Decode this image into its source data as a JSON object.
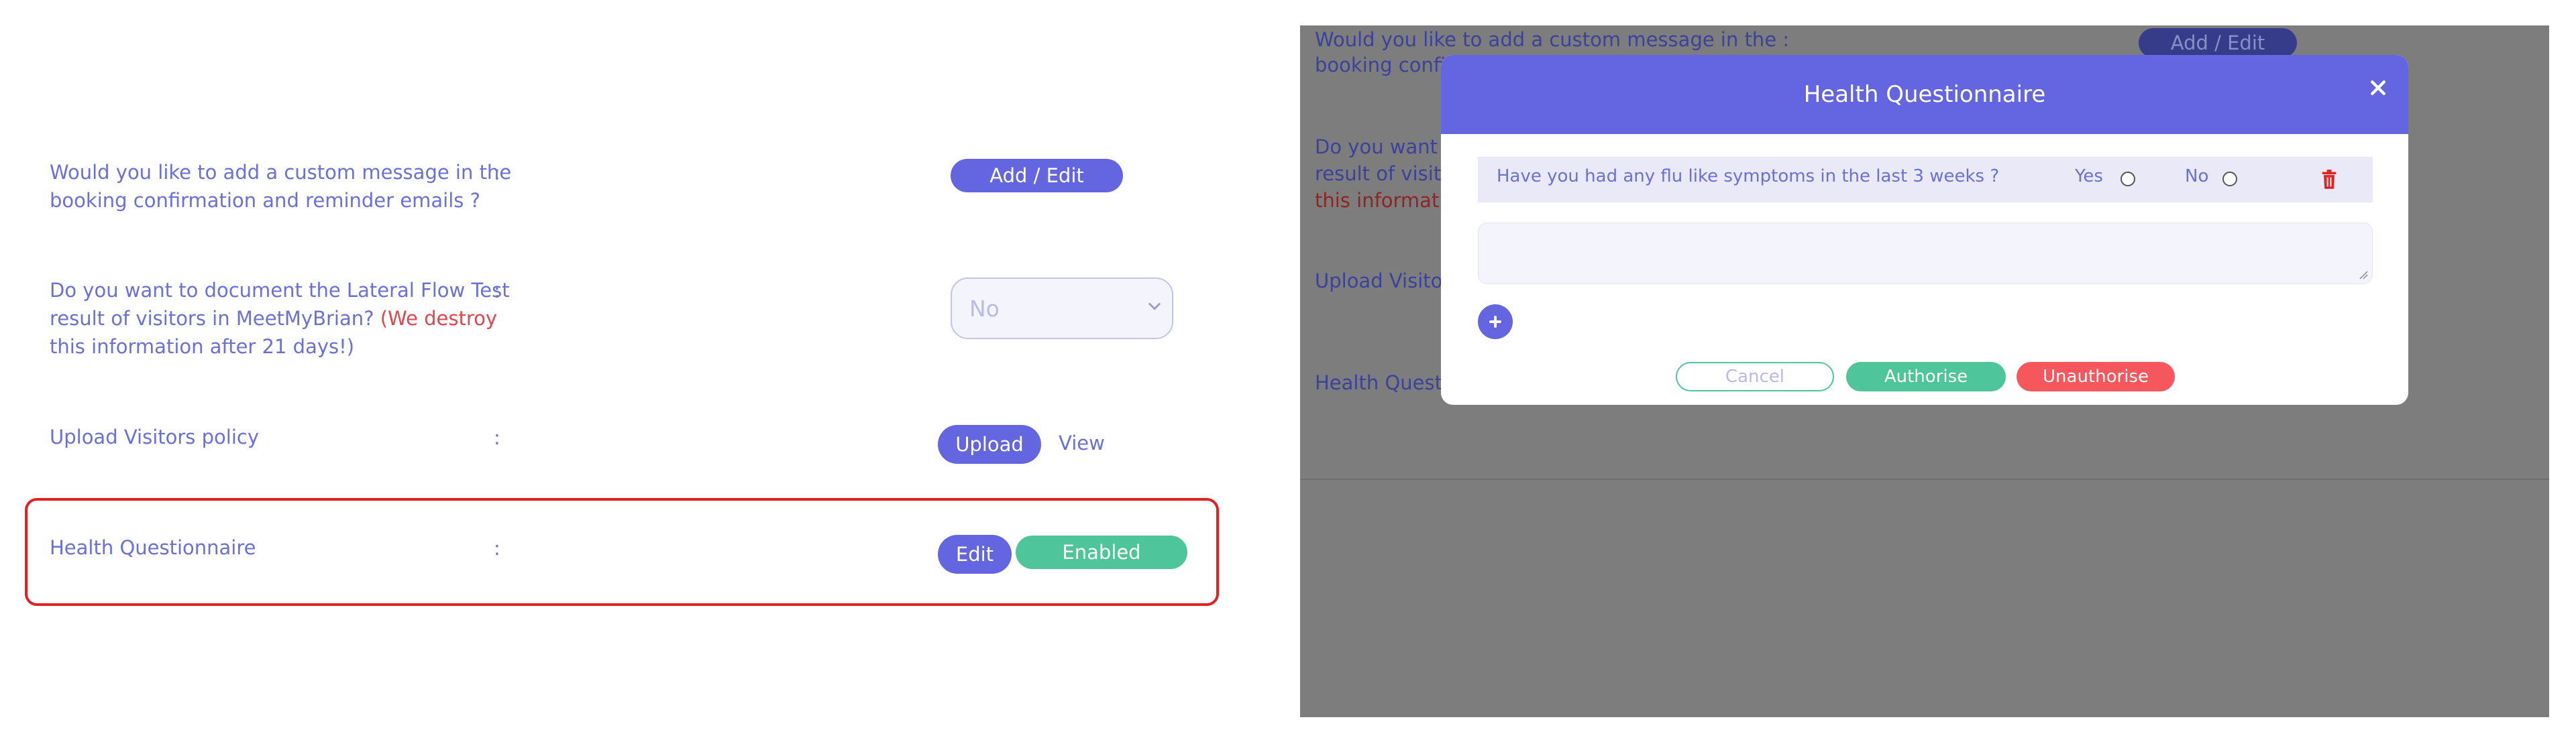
{
  "settings": {
    "custom_message": {
      "label_line1": "Would you like to add a custom message in the",
      "label_line2": "booking confirmation and reminder emails ?",
      "colon": ":",
      "button": "Add / Edit"
    },
    "lateral_flow": {
      "label_line1": "Do you want to document the Lateral Flow Test",
      "label_line2_prefix": "result of visitors in MeetMyBrian?",
      "label_line2_warning": "(We destroy",
      "label_line3_warning": "this information after 21 days!)",
      "colon": ":",
      "select_value": "No"
    },
    "visitors_policy": {
      "label": "Upload Visitors policy",
      "colon": ":",
      "upload_button": "Upload",
      "view_link": "View"
    },
    "health_questionnaire": {
      "label": "Health Questionnaire",
      "colon": ":",
      "edit_button": "Edit",
      "status": "Enabled"
    }
  },
  "background_overlay": {
    "custom_message_line1": "Would you like to add a custom message in the :",
    "custom_message_line2": "booking confir",
    "add_edit": "Add / Edit",
    "lateral_line1": "Do you want to",
    "lateral_line2": "result of visitor",
    "lateral_line3": "this informatio",
    "upload_label": "Upload Visitors",
    "health_label": "Health Questio"
  },
  "modal": {
    "title": "Health Questionnaire",
    "question": "Have you had any flu like symptoms in the last 3 weeks ?",
    "option_yes": "Yes",
    "option_no": "No",
    "cancel": "Cancel",
    "authorise": "Authorise",
    "unauthorise": "Unauthorise"
  },
  "icons": {
    "close": "close-icon",
    "trash": "trash-icon",
    "add": "plus-icon",
    "chevron": "chevron-down-icon"
  },
  "colors": {
    "primary": "#6366e0",
    "success": "#4ec59b",
    "danger": "#f5575c",
    "highlight": "#e02222"
  }
}
